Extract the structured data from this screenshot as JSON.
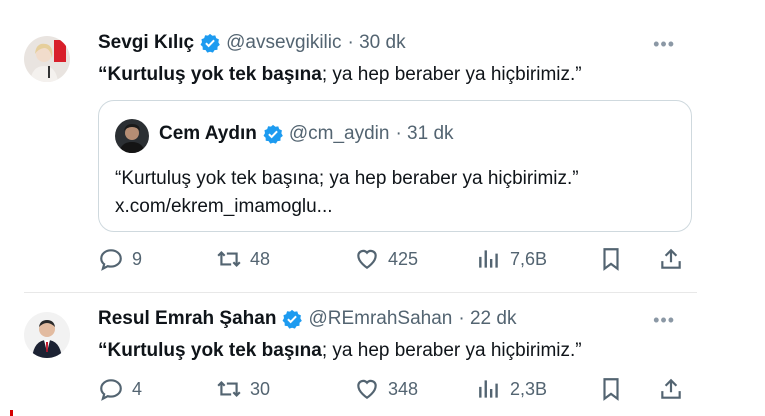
{
  "tweets": [
    {
      "name": "Sevgi Kılıç",
      "handle": "@avsevgikilic",
      "time": "· 30 dk",
      "more": "•••",
      "text_bold": "“Kurtuluş yok tek başına",
      "text_rest": "; ya hep beraber ya hiçbirimiz.”",
      "quote": {
        "name": "Cem Aydın",
        "handle": "@cm_aydin",
        "time": "· 31 dk",
        "line1": "“Kurtuluş yok tek başına; ya hep beraber ya hiçbirimiz.”",
        "line2": "x.com/ekrem_imamoglu..."
      },
      "replies": "9",
      "retweets": "48",
      "likes": "425",
      "views": "7,6B"
    },
    {
      "name": "Resul Emrah Şahan",
      "handle": "@REmrahSahan",
      "time": "· 22 dk",
      "more": "•••",
      "text_bold": "“Kurtuluş yok tek başına",
      "text_rest": "; ya hep beraber ya hiçbirimiz.”",
      "replies": "4",
      "retweets": "30",
      "likes": "348",
      "views": "2,3B"
    }
  ],
  "colors": {
    "verified": "#1d9bf0",
    "muted": "#536471",
    "border": "#cfd9de"
  }
}
